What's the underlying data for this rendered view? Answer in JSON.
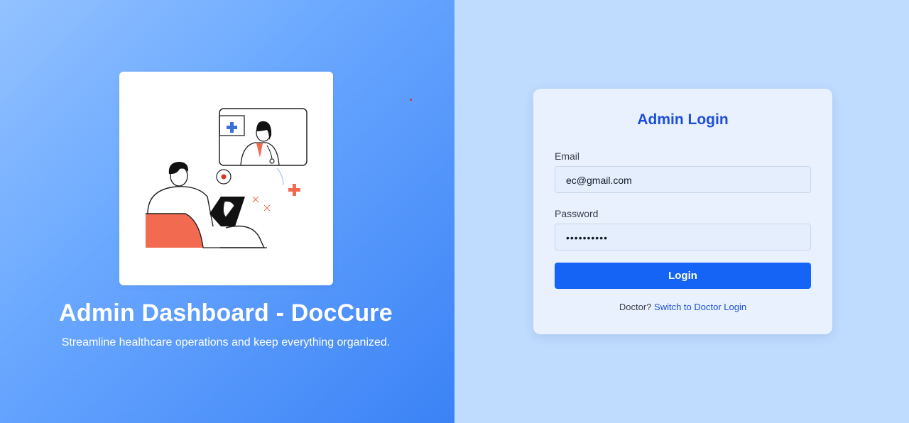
{
  "hero": {
    "title": "Admin Dashboard - DocCure",
    "subtitle": "Streamline healthcare operations and keep everything organized."
  },
  "illustration": {
    "name": "doctor-video-consultation-illustration",
    "accent": "#f26b50",
    "icon_blue": "#3b6fd8"
  },
  "login": {
    "title": "Admin Login",
    "email_label": "Email",
    "email_value": "ec@gmail.com",
    "password_label": "Password",
    "password_value": "••••••••••",
    "button_label": "Login",
    "switch_prompt": "Doctor?",
    "switch_link": "Switch to Doctor Login"
  },
  "colors": {
    "primary": "#1664f5",
    "title_blue": "#1d4ed8",
    "panel_bg": "#bfdbfe",
    "card_bg": "#e8f1fd"
  }
}
